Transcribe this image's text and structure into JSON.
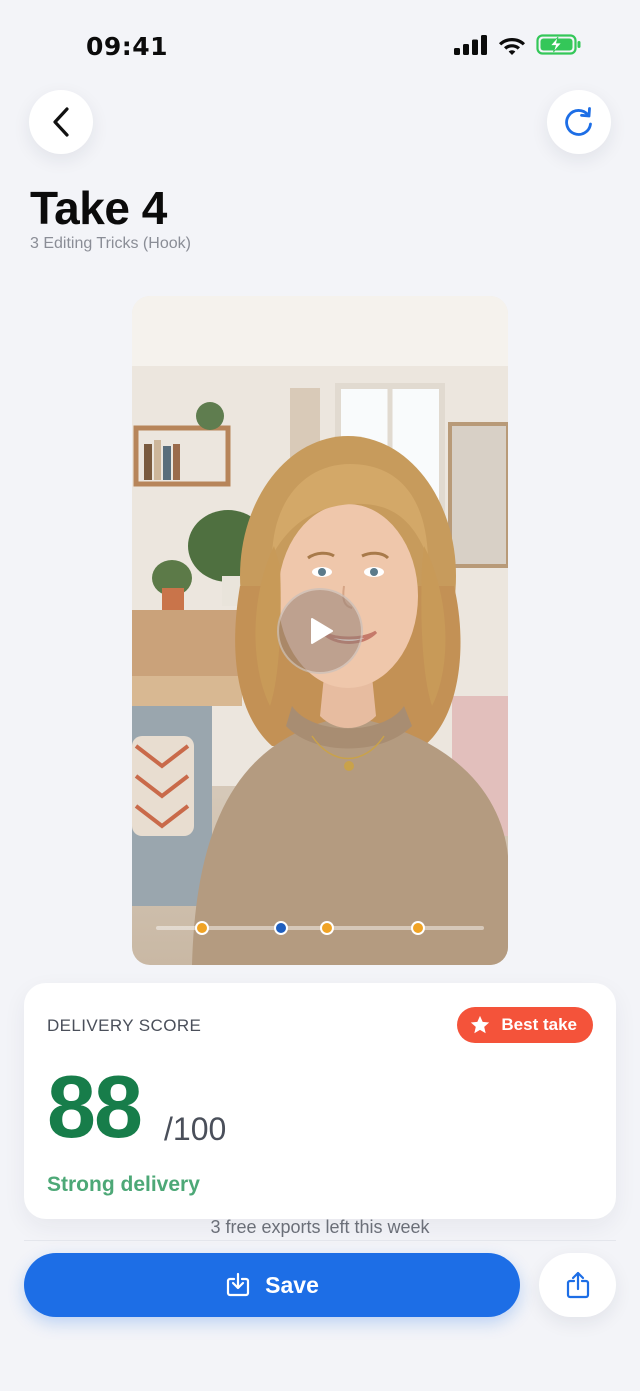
{
  "status_bar": {
    "time": "09:41",
    "icons": [
      "signal-icon",
      "wifi-icon",
      "battery-charging-icon"
    ],
    "battery_color": "#34c759"
  },
  "nav": {
    "back_icon": "chevron-left-icon",
    "redo_icon": "redo-icon"
  },
  "header": {
    "title": "Take 4",
    "subtitle": "3 Editing Tricks (Hook)"
  },
  "video": {
    "play_icon": "play-icon",
    "markers": [
      {
        "position": 0.14,
        "color": "#f0a325"
      },
      {
        "position": 0.38,
        "color": "#1f5fbf"
      },
      {
        "position": 0.52,
        "color": "#f0a325"
      },
      {
        "position": 0.8,
        "color": "#f0a325"
      }
    ]
  },
  "score": {
    "label": "DELIVERY SCORE",
    "badge_label": "Best take",
    "badge_icon": "star-icon",
    "value": "88",
    "max": "/100",
    "description": "Strong delivery",
    "value_color": "#177d4a",
    "badge_color": "#f4533a"
  },
  "footer": {
    "exports_note": "3 free exports left this week",
    "save_label": "Save",
    "save_icon": "download-icon",
    "share_icon": "share-icon",
    "accent": "#1d6ee6"
  }
}
